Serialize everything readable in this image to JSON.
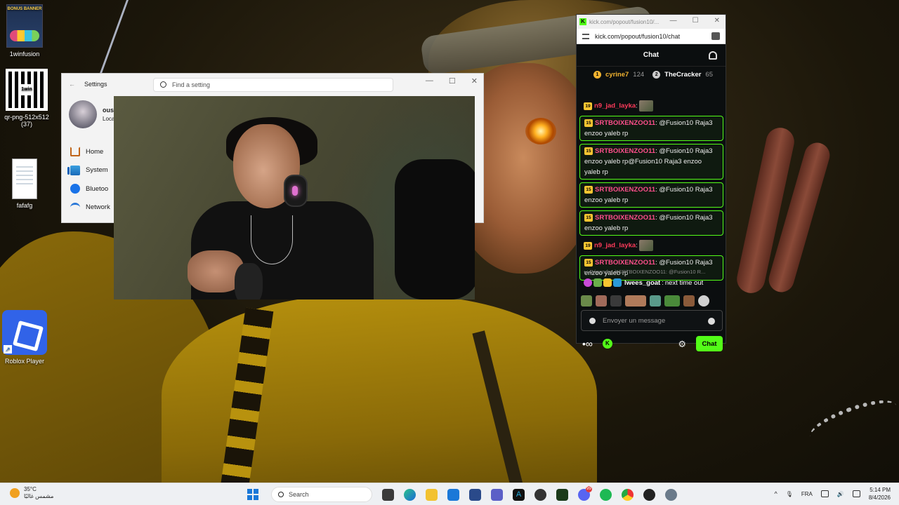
{
  "desktop": {
    "icons": [
      {
        "label": "1winfusion",
        "thumb_text": "BONUS BANNER"
      },
      {
        "label": "qr-png-512x512 (37)",
        "thumb_text": "1win"
      },
      {
        "label": "fafafg"
      },
      {
        "label": "Roblox Player"
      }
    ]
  },
  "settings_window": {
    "title": "Settings",
    "search_placeholder": "Find a setting",
    "profile_name": "ous",
    "profile_sub": "Loca",
    "nav": [
      {
        "label": "Home",
        "icon": "home-icon"
      },
      {
        "label": "System",
        "icon": "system-icon"
      },
      {
        "label": "Bluetoo",
        "icon": "bluetooth-icon"
      },
      {
        "label": "Network",
        "icon": "network-icon"
      }
    ]
  },
  "chat_window": {
    "tab_title": "kick.com/popout/fusion10/...",
    "address": "kick.com/popout/fusion10/chat",
    "header": "Chat",
    "leaderboard": [
      {
        "rank": "1",
        "name": "cyrine7",
        "points": "124"
      },
      {
        "rank": "2",
        "name": "TheCracker",
        "points": "65"
      }
    ],
    "messages": [
      {
        "badge": "19",
        "user": "n9_jad_layka",
        "text": "",
        "highlight": false
      },
      {
        "badge": "15",
        "user": "SRTBOIXENZOO11",
        "text": "@Fusion10 Raja3 enzoo yaleb rp",
        "highlight": true
      },
      {
        "badge": "15",
        "user": "SRTBOIXENZOO11",
        "text": "@Fusion10 Raja3 enzoo yaleb rp@Fusion10 Raja3 enzoo yaleb rp",
        "highlight": true
      },
      {
        "badge": "15",
        "user": "SRTBOIXENZOO11",
        "text": "@Fusion10 Raja3 enzoo yaleb rp",
        "highlight": true
      },
      {
        "badge": "15",
        "user": "SRTBOIXENZOO11",
        "text": "@Fusion10 Raja3 enzoo yaleb rp",
        "highlight": true
      },
      {
        "badge": "19",
        "user": "n9_jad_layka",
        "text": "",
        "highlight": false
      },
      {
        "badge": "15",
        "user": "SRTBOIXENZOO11",
        "text": "@Fusion10 Raja3 enzoo yaleb rp",
        "highlight": true
      }
    ],
    "reply_to": "Répondre à SRTBOIXENZOO11: @Fusion10 R...",
    "reply_user": "lwees_goat",
    "reply_text": "next time out",
    "input_placeholder": "Envoyer un message",
    "send_label": "Chat"
  },
  "taskbar": {
    "temperature": "35°C",
    "weather_text": "مشمس غالبًا",
    "search_label": "Search",
    "language": "FRA",
    "time": "5:14 PM",
    "date": "8/4/2026",
    "discord_badge": "99"
  },
  "colors": {
    "kick_green": "#53fc18",
    "username_pink": "#ff4f8c",
    "badge_gold": "#f7c531"
  }
}
